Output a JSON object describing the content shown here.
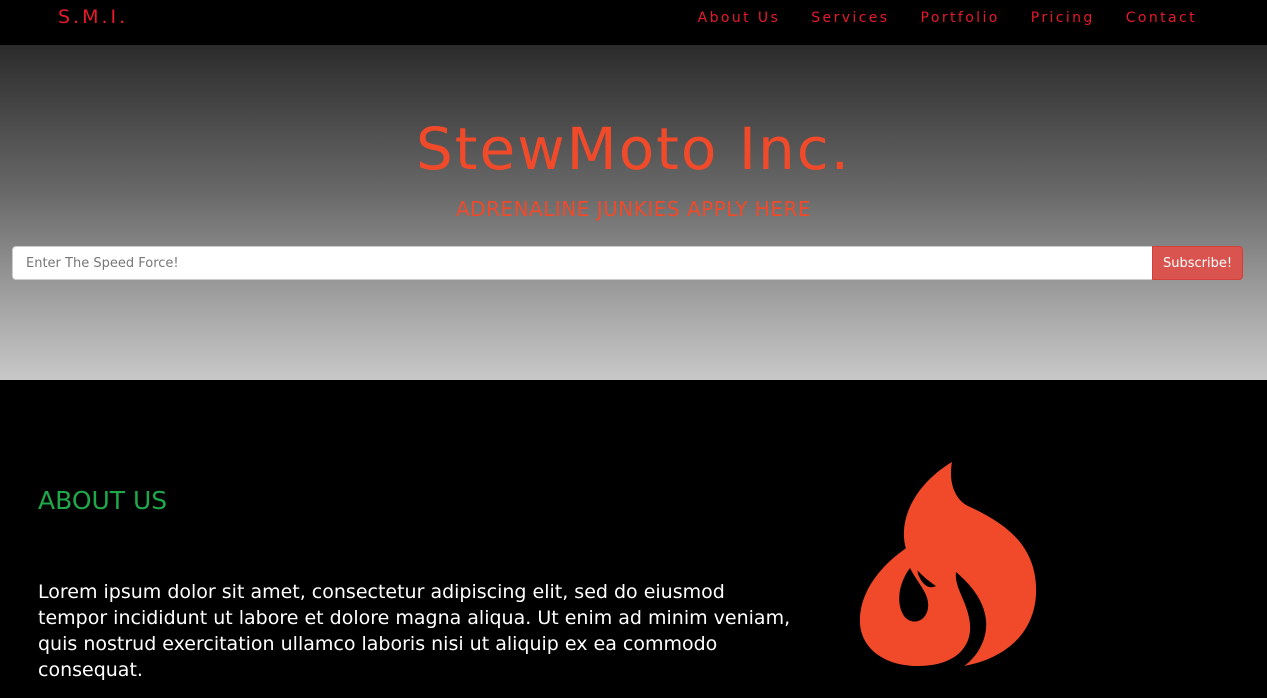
{
  "nav": {
    "brand": "S.M.I.",
    "links": [
      "About Us",
      "Services",
      "Portfolio",
      "Pricing",
      "Contact"
    ]
  },
  "hero": {
    "title": "StewMoto Inc.",
    "tagline": "ADRENALINE JUNKIES APPLY HERE",
    "input_placeholder": "Enter The Speed Force!",
    "subscribe_label": "Subscribe!"
  },
  "about": {
    "heading": "ABOUT US",
    "body": "Lorem ipsum dolor sit amet, consectetur adipiscing elit, sed do eiusmod tempor incididunt ut labore et dolore magna aliqua. Ut enim ad minim veniam, quis nostrud exercitation ullamco laboris nisi ut aliquip ex ea commodo consequat.",
    "icon": "flame-icon"
  },
  "colors": {
    "nav_accent": "#e8192c",
    "hero_text": "#f04a2a",
    "about_heading": "#1fa84a",
    "subscribe_button": "#d9534f",
    "flame": "#f04a2a"
  }
}
